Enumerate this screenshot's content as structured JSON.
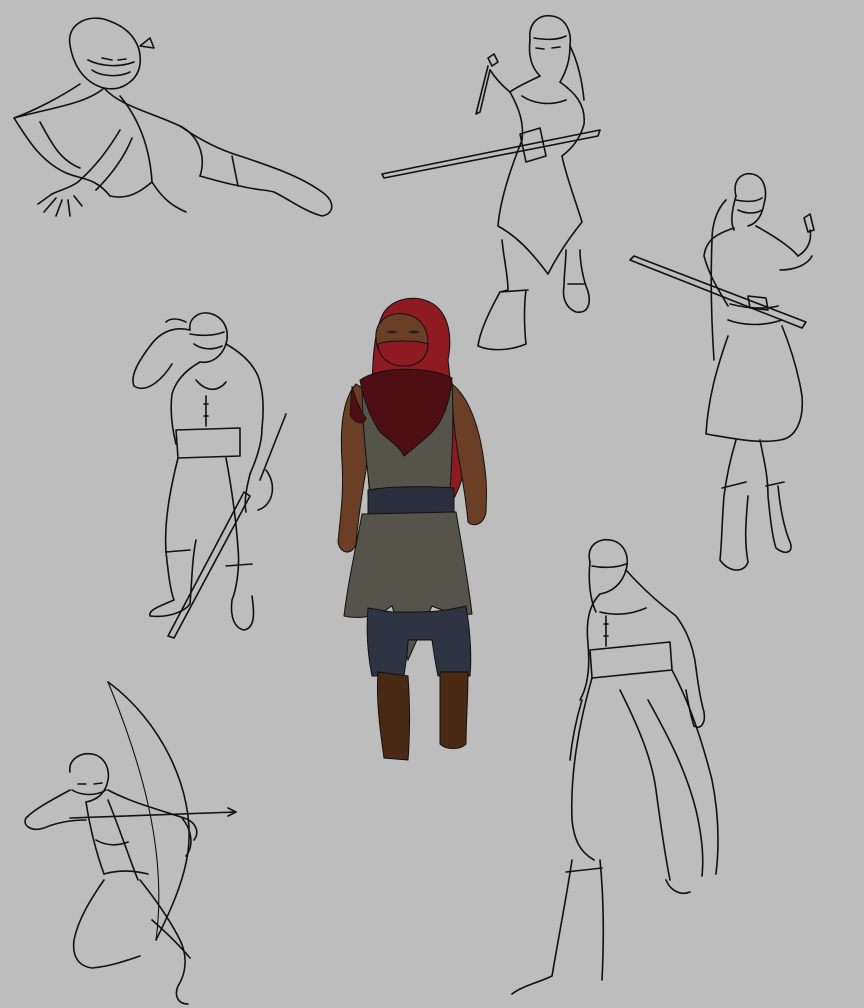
{
  "canvas": {
    "background": "#bdbdbd"
  },
  "palette": {
    "line": "#111111",
    "hood": "#8e1a22",
    "mantle": "#4e0f14",
    "skin": "#6b3f26",
    "tunic": "#56534a",
    "belt": "#2b2f3d",
    "pants": "#2f3442",
    "boots": "#4a2a14"
  },
  "figures": [
    {
      "name": "crouching-lunge-sketch",
      "pose": "lunge",
      "style": "line-art"
    },
    {
      "name": "swordsman-with-dagger-sketch",
      "pose": "standing-sword",
      "style": "line-art"
    },
    {
      "name": "sword-drawing-sketch",
      "pose": "drawing-sword",
      "style": "line-art"
    },
    {
      "name": "head-touch-sword-sketch",
      "pose": "standing-head-touch",
      "style": "line-art"
    },
    {
      "name": "colored-hooded-assassin",
      "pose": "standing",
      "style": "colored"
    },
    {
      "name": "walking-hooded-sketch",
      "pose": "walking",
      "style": "line-art"
    },
    {
      "name": "archer-kneeling-sketch",
      "pose": "drawing-bow",
      "style": "line-art"
    }
  ]
}
